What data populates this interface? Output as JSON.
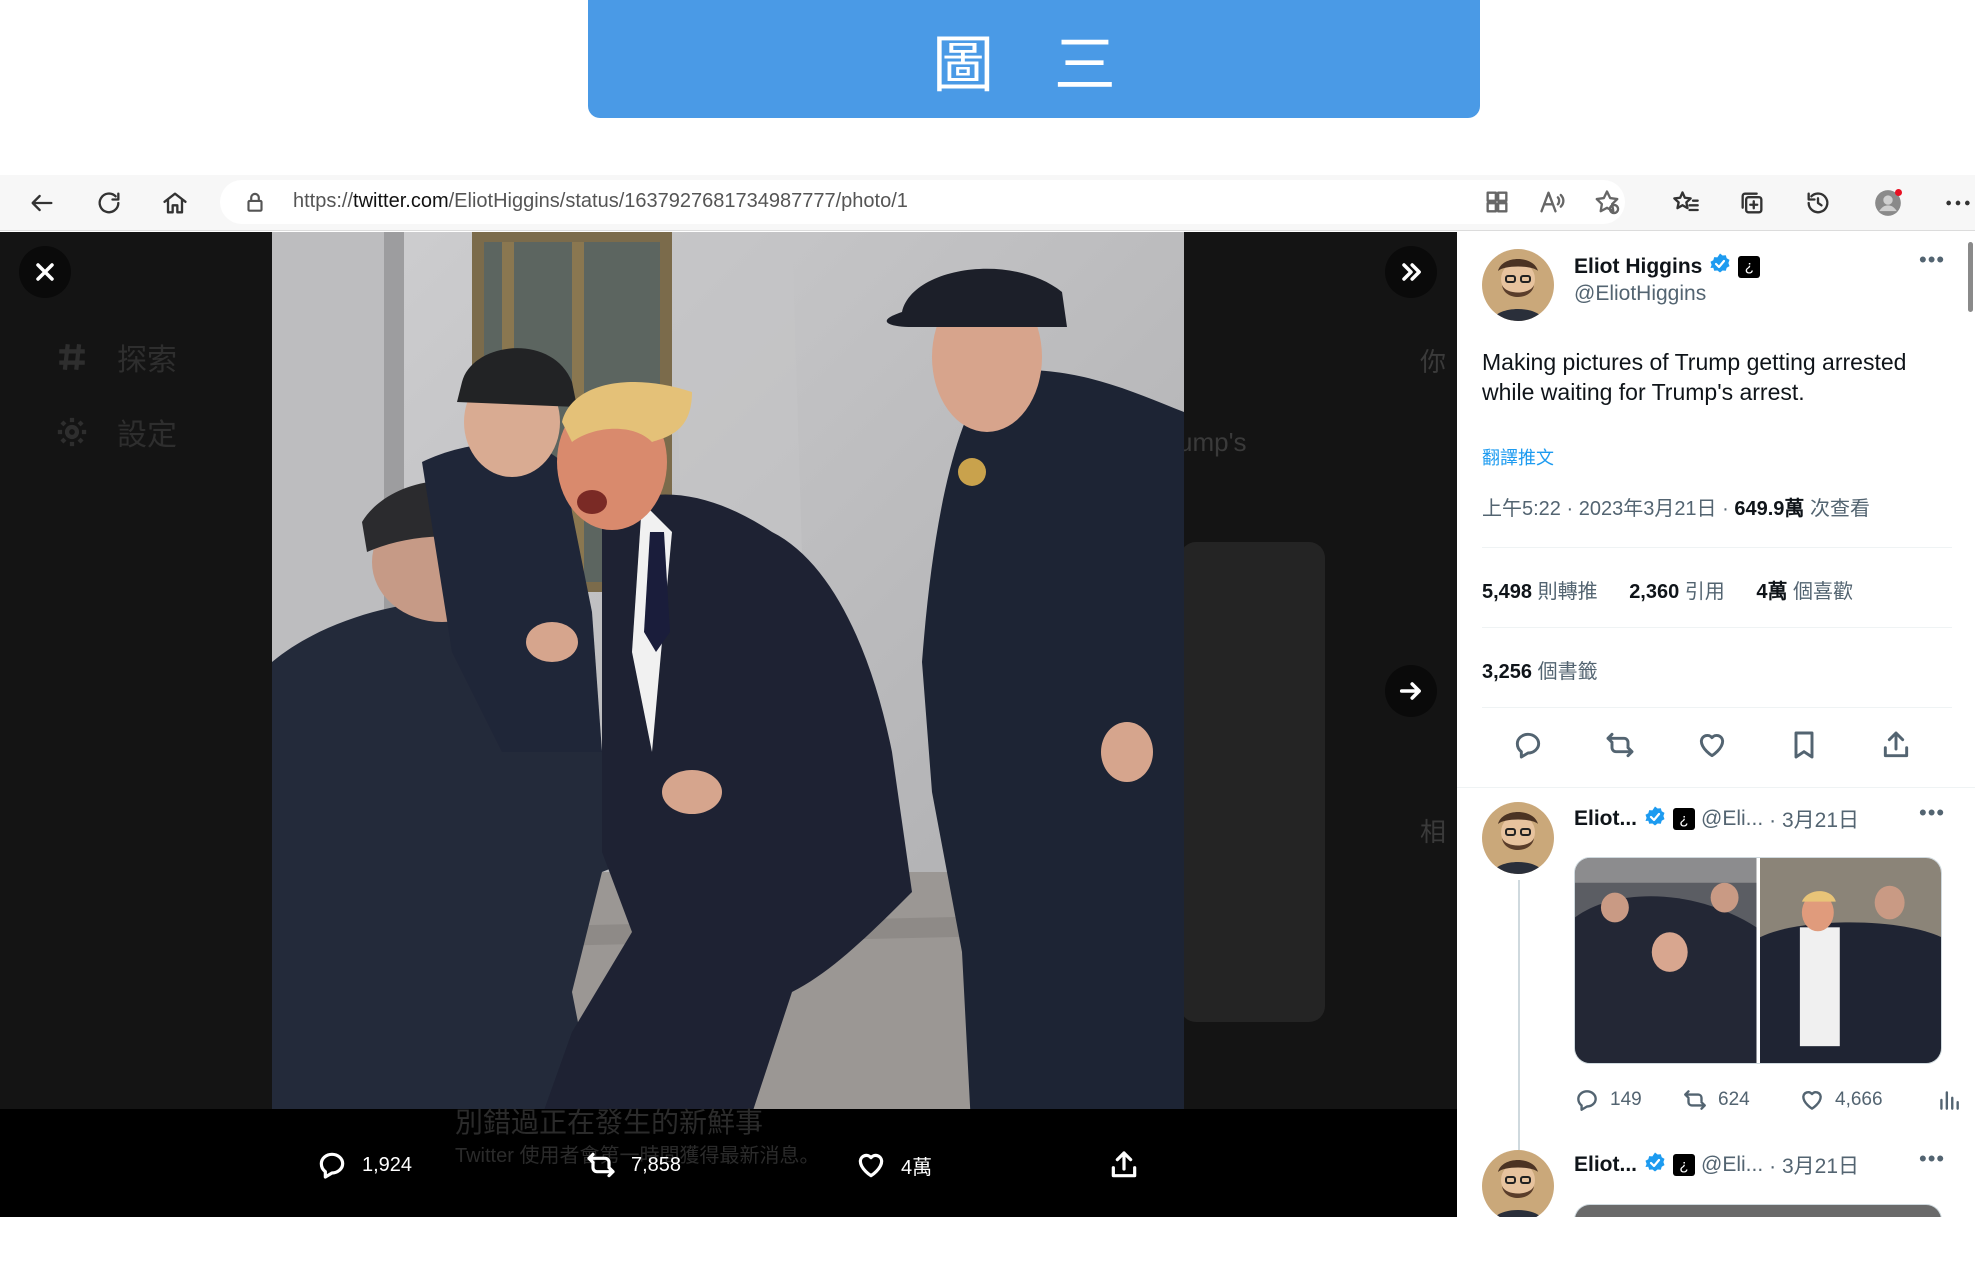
{
  "banner": {
    "title": "圖 三"
  },
  "browser": {
    "url_prefix": "https://",
    "url_domain": "twitter.com",
    "url_path": "/EliotHiggins/status/1637927681734987777/photo/1",
    "icons": [
      "back-icon",
      "refresh-icon",
      "home-icon",
      "lock-icon",
      "apps-icon",
      "read-aloud-icon",
      "add-favorite-icon",
      "favorites-icon",
      "collections-icon",
      "history-icon",
      "profile-icon",
      "more-icon"
    ]
  },
  "background_page": {
    "sidebar": [
      {
        "label": "探索",
        "icon": "hashtag-icon"
      },
      {
        "label": "設定",
        "icon": "gear-icon"
      }
    ],
    "fragments": {
      "trumps": "ump's",
      "you": "你",
      "related": "相",
      "banner_line1": "別錯過正在發生的新鮮事",
      "banner_line2": "Twitter 使用者會第一時間獲得最新消息。"
    }
  },
  "viewer": {
    "actions": {
      "replies": "1,924",
      "retweets": "7,858",
      "likes": "4萬"
    }
  },
  "tweet": {
    "author_name": "Eliot Higgins",
    "author_handle": "@EliotHiggins",
    "affiliation_glyph": "¿",
    "text": "Making pictures of Trump getting arrested while waiting for Trump's arrest.",
    "translate_label": "翻譯推文",
    "time": "上午5:22 · 2023年3月21日 · ",
    "views_count": "649.9萬",
    "views_label": " 次查看",
    "stats": {
      "retweets_count": "5,498",
      "retweets_label": " 則轉推",
      "quotes_count": "2,360",
      "quotes_label": " 引用",
      "likes_count": "4萬",
      "likes_label": " 個喜歡",
      "bookmarks_count": "3,256",
      "bookmarks_label": " 個書籤"
    }
  },
  "replies": [
    {
      "author_name": "Eliot...",
      "author_handle": "@Eli...",
      "date": " · 3月21日",
      "counts": {
        "replies": "149",
        "retweets": "624",
        "likes": "4,666"
      }
    },
    {
      "author_name": "Eliot...",
      "author_handle": "@Eli...",
      "date": " · 3月21日"
    }
  ],
  "colors": {
    "banner": "#4a9ae6",
    "link": "#1d9bf0",
    "verified": "#1d9bf0",
    "viewer_bg": "#141414"
  }
}
